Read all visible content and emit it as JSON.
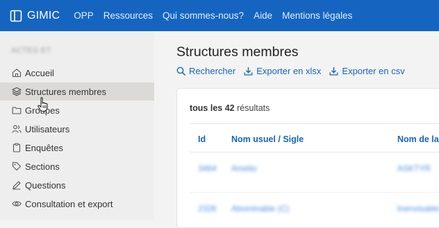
{
  "header": {
    "brand": "GIMIC",
    "nav": [
      "OPP",
      "Ressources",
      "Qui sommes-nous?",
      "Aide",
      "Mentions légales"
    ]
  },
  "sidebar": {
    "section_label": "ACTES ET",
    "items": [
      {
        "label": "Accueil",
        "icon": "home-icon"
      },
      {
        "label": "Structures membres",
        "icon": "layers-icon"
      },
      {
        "label": "Groupes",
        "icon": "folder-icon"
      },
      {
        "label": "Utilisateurs",
        "icon": "users-icon"
      },
      {
        "label": "Enquêtes",
        "icon": "clipboard-icon"
      },
      {
        "label": "Sections",
        "icon": "tag-icon"
      },
      {
        "label": "Questions",
        "icon": "pencil-icon"
      },
      {
        "label": "Consultation et export",
        "icon": "eye-icon"
      }
    ]
  },
  "main": {
    "title": "Structures membres",
    "actions": [
      {
        "label": "Rechercher",
        "icon": "search-icon"
      },
      {
        "label": "Exporter en xlsx",
        "icon": "download-icon"
      },
      {
        "label": "Exporter en csv",
        "icon": "download-icon"
      }
    ],
    "results": {
      "prefix": "tous les",
      "count": "42",
      "suffix": "résultats"
    },
    "table": {
      "columns": [
        "Id",
        "Nom usuel / Sigle",
        "Nom de la"
      ],
      "rows": [
        [
          "3464",
          "Amelio",
          "ASKTYR"
        ],
        [
          "2326",
          "Abominable (C)",
          "Inenvisable"
        ]
      ]
    }
  },
  "colors": {
    "primary": "#1565c0",
    "sidebar": "#eeeeee",
    "active": "#dcdad6"
  }
}
